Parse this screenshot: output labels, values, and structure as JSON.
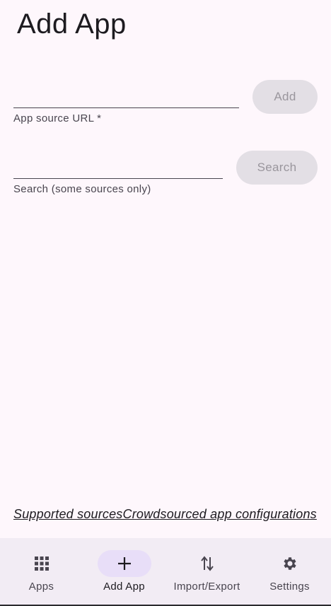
{
  "header": {
    "title": "Add App"
  },
  "form": {
    "url_field": {
      "value": "",
      "label": "App source URL *"
    },
    "add_button_label": "Add",
    "search_field": {
      "value": "",
      "label": "Search (some sources only)"
    },
    "search_button_label": "Search"
  },
  "links": {
    "supported_sources": "Supported sources",
    "crowdsourced": "Crowdsourced app configurations"
  },
  "bottom_nav": {
    "items": [
      {
        "label": "Apps",
        "icon": "grid-icon"
      },
      {
        "label": "Add App",
        "icon": "plus-icon",
        "active": true
      },
      {
        "label": "Import/Export",
        "icon": "import-export-icon"
      },
      {
        "label": "Settings",
        "icon": "gear-icon"
      }
    ]
  },
  "colors": {
    "background": "#fef7fc",
    "nav_background": "#f2ecf4",
    "active_indicator": "#e8def8",
    "disabled_button": "#e3dfe5"
  }
}
